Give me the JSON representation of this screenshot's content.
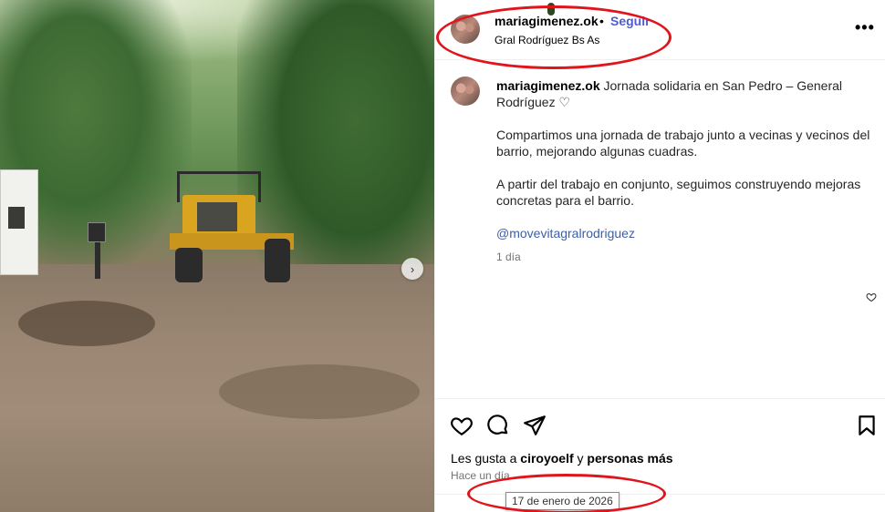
{
  "post": {
    "username": "mariagimenez.ok",
    "dot": "•",
    "follow_label": "Seguir",
    "location": "Gral Rodríguez Bs As",
    "more_label": "•••"
  },
  "caption": {
    "username": "mariagimenez.ok",
    "title": "Jornada solidaria en San Pedro – General Rodríguez",
    "heart_emoji": "♡",
    "paragraph1": "Compartimos una jornada de trabajo junto a vecinas y vecinos del barrio, mejorando algunas cuadras.",
    "paragraph2": "A partir del trabajo en conjunto, seguimos construyendo mejoras concretas para el barrio.",
    "mention": "@movevitagralrodriguez",
    "time": "1 día"
  },
  "actions": {
    "likes_prefix": "Les gusta a ",
    "likes_user": "ciroyoelf",
    "likes_mid": " y ",
    "likes_rest": "personas más",
    "ago": "Hace un día",
    "tooltip": "17 de enero de 2026"
  },
  "carousel": {
    "next_label": "›"
  },
  "icons": [
    "heart-icon",
    "comment-icon",
    "share-icon",
    "bookmark-icon",
    "more-icon",
    "chevron-right-icon",
    "heart-small-icon"
  ],
  "colors": {
    "follow": "#4f5bd5",
    "mention": "#3e5fa8",
    "annotation": "#e0151b"
  }
}
